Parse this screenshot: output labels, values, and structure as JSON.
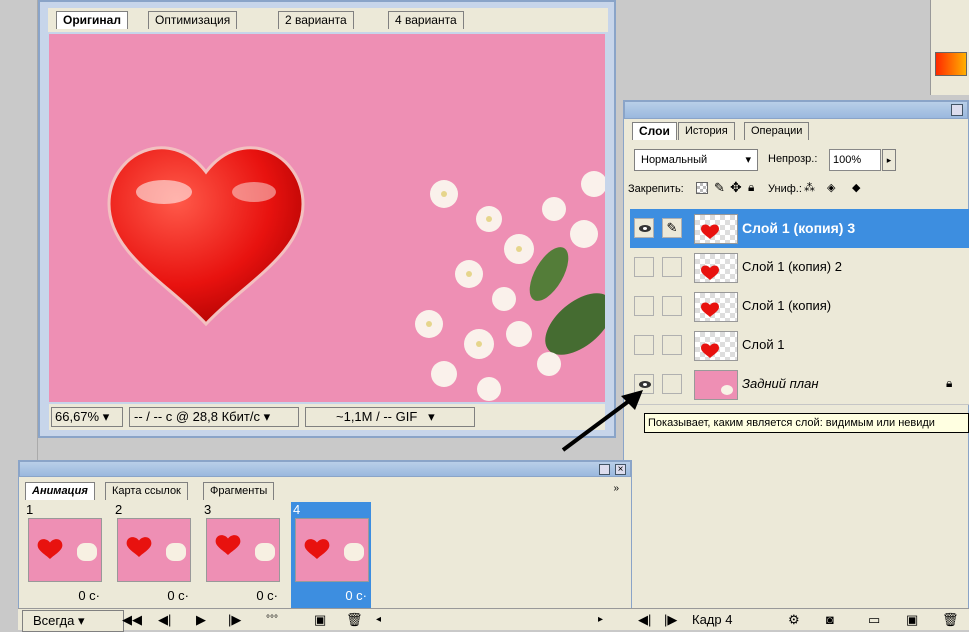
{
  "doc_tabs": [
    "Оригинал",
    "Оптимизация",
    "2 варианта",
    "4 варианта"
  ],
  "doc_status": {
    "zoom": "66,67%",
    "speed": "-- / -- с @ 28,8 Кбит/с",
    "size": "~1,1M / -- GIF"
  },
  "layers_panel": {
    "tabs": [
      "Слои",
      "История",
      "Операции"
    ],
    "blend_mode": "Нормальный",
    "opacity_label": "Непрозр.:",
    "opacity_value": "100%",
    "lock_label": "Закрепить:",
    "unify_label": "Униф.:",
    "layers": [
      {
        "name": "Слой 1 (копия) 3",
        "visible": true,
        "selected": true
      },
      {
        "name": "Слой 1 (копия) 2",
        "visible": false,
        "selected": false
      },
      {
        "name": "Слой 1 (копия)",
        "visible": false,
        "selected": false
      },
      {
        "name": "Слой 1",
        "visible": false,
        "selected": false
      },
      {
        "name": "Задний план",
        "visible": true,
        "selected": false
      }
    ],
    "tooltip": "Показывает, каким является слой: видимым или невиди",
    "frame_label": "Кадр 4"
  },
  "animation_panel": {
    "tabs": [
      "Анимация",
      "Карта ссылок",
      "Фрагменты"
    ],
    "frames": [
      {
        "num": "1",
        "delay": "0 с"
      },
      {
        "num": "2",
        "delay": "0 с"
      },
      {
        "num": "3",
        "delay": "0 с"
      },
      {
        "num": "4",
        "delay": "0 с"
      }
    ],
    "loop": "Всегда"
  },
  "colors": {
    "canvas_pink": "#ee8fb4",
    "selection_blue": "#3d8ee0",
    "heart_red": "#e8120f"
  },
  "icons": [
    "eye-icon",
    "brush-icon",
    "lock-icon",
    "play-icon",
    "trash-icon",
    "new-layer-icon"
  ]
}
